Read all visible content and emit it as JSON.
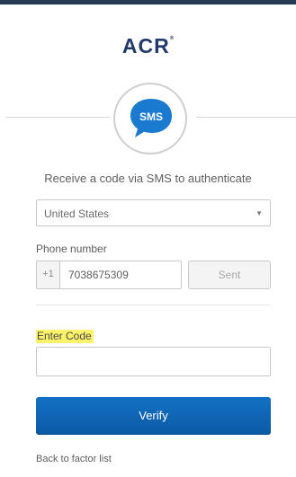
{
  "logo": {
    "text": "ACR",
    "mark": "®"
  },
  "factor": {
    "icon": "sms-bubble-icon",
    "badge_text": "SMS",
    "bubble_color": "#1a7ad0"
  },
  "instructions": "Receive a code via SMS to authenticate",
  "country_select": {
    "selected": "United States"
  },
  "phone": {
    "label": "Phone number",
    "country_code": "+1",
    "value": "7038675309",
    "send_button_label": "Sent"
  },
  "code": {
    "label": "Enter Code",
    "value": "",
    "highlight_color": "#fcf36a"
  },
  "verify_button_label": "Verify",
  "back_link_label": "Back to factor list",
  "colors": {
    "accent": "#1470c4",
    "top_bar": "#243b53",
    "logo": "#223a6b"
  }
}
